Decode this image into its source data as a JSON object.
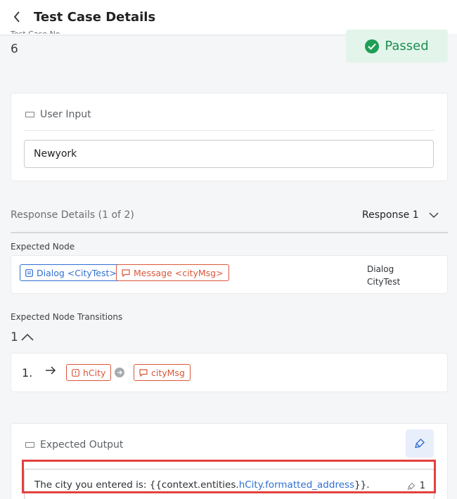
{
  "header": {
    "title": "Test Case Details"
  },
  "test_case": {
    "label": "Test Case No.",
    "number": "6",
    "status": "Passed"
  },
  "user_input": {
    "title": "User Input",
    "value": "Newyork"
  },
  "response": {
    "title": "Response Details (1 of 2)",
    "selected": "Response 1",
    "expected_node_label": "Expected Node",
    "dialog_chip": "Dialog <CityTest>",
    "message_chip": "Message <cityMsg>",
    "side_line1": "Dialog",
    "side_line2": "CityTest"
  },
  "transitions": {
    "label": "Expected Node Transitions",
    "count": "1",
    "index": "1.",
    "chip1": "hCity",
    "chip2": "cityMsg"
  },
  "expected_output": {
    "title": "Expected Output",
    "text_prefix": "The city you entered is: {{context.entities.",
    "text_highlight": "hCity.formatted_address",
    "text_suffix": "}}.",
    "count": "1"
  },
  "colors": {
    "accent": "#2f6fd1",
    "success": "#1e9e56",
    "node_red": "#d9573b",
    "annotation_red": "#e2413f"
  }
}
